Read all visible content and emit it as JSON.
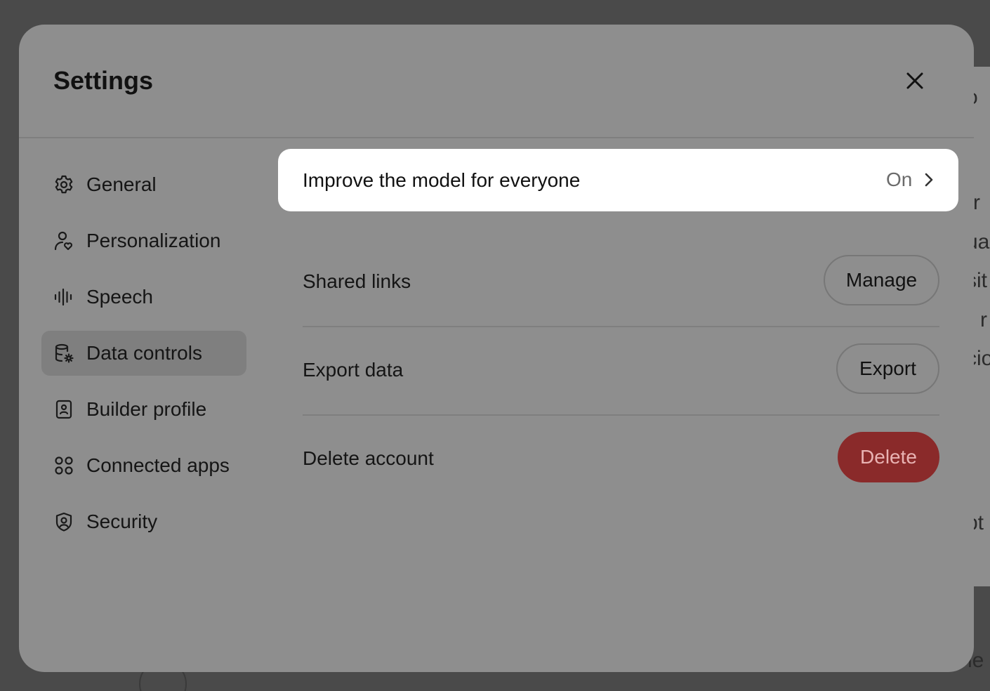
{
  "background": {
    "fragments": [
      "o",
      "rr",
      "ua",
      "sit",
      "r",
      "cio",
      "pt",
      "he"
    ]
  },
  "modal": {
    "title": "Settings",
    "close_icon": "close-icon"
  },
  "sidebar": {
    "items": [
      {
        "label": "General",
        "icon": "gear-icon",
        "active": false
      },
      {
        "label": "Personalization",
        "icon": "person-heart-icon",
        "active": false
      },
      {
        "label": "Speech",
        "icon": "waveform-icon",
        "active": false
      },
      {
        "label": "Data controls",
        "icon": "database-gear-icon",
        "active": true
      },
      {
        "label": "Builder profile",
        "icon": "id-badge-icon",
        "active": false
      },
      {
        "label": "Connected apps",
        "icon": "apps-grid-icon",
        "active": false
      },
      {
        "label": "Security",
        "icon": "shield-user-icon",
        "active": false
      }
    ]
  },
  "content": {
    "improve_model": {
      "label": "Improve the model for everyone",
      "value": "On",
      "icon": "chevron-right-icon"
    },
    "shared_links": {
      "label": "Shared links",
      "button": "Manage"
    },
    "export_data": {
      "label": "Export data",
      "button": "Export"
    },
    "delete_account": {
      "label": "Delete account",
      "button": "Delete"
    }
  },
  "colors": {
    "overlay": "#4a4a4a",
    "modal_bg": "#8e8e8e",
    "highlight_bg": "#ffffff",
    "danger": "#8a2a2a"
  }
}
